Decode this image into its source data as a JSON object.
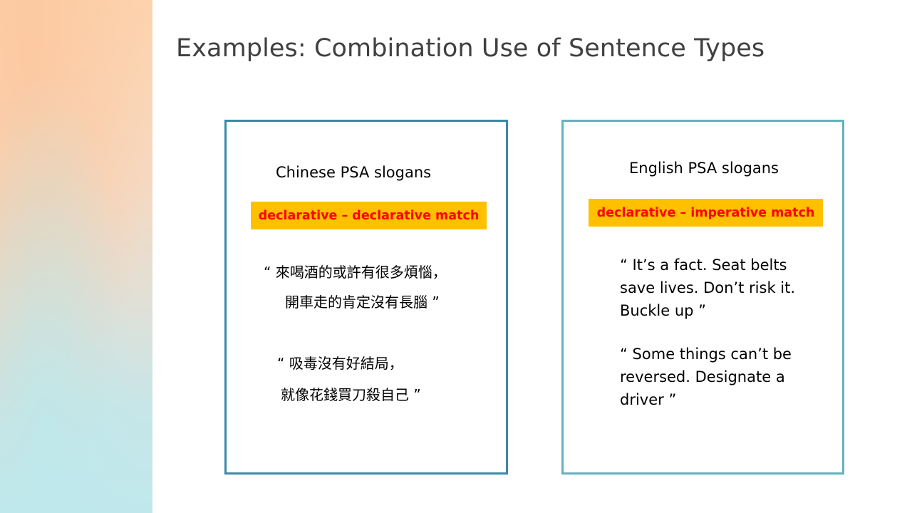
{
  "slide": {
    "title": "Examples: Combination Use of Sentence Types"
  },
  "left_card": {
    "heading": "Chinese PSA slogans",
    "badge": "declarative – declarative match",
    "slogan1_line1": "“ 來喝酒的或許有很多煩惱，",
    "slogan1_line2": "開車走的肯定沒有長腦 ”",
    "slogan2_line1": "“ 吸毒沒有好結局，",
    "slogan2_line2": "就像花錢買刀殺自己 ”"
  },
  "right_card": {
    "heading": "English PSA slogans",
    "badge": "declarative – imperative match",
    "slogan1": "“ It’s a fact. Seat belts save lives. Don’t risk it. Buckle up ”",
    "slogan2": "“ Some things can’t be reversed. Designate a driver ”"
  },
  "colors": {
    "left_border": "#3a8aa8",
    "right_border": "#62b3bd",
    "badge_background": "#ffc000",
    "badge_text": "#ff0000",
    "title_text": "#404040"
  }
}
